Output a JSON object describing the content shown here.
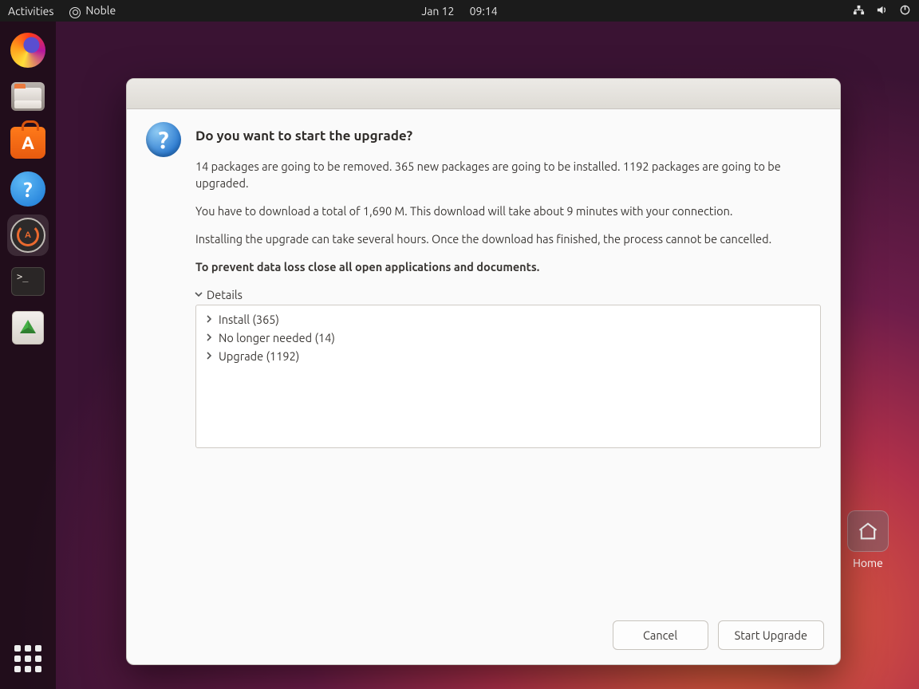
{
  "topbar": {
    "activities": "Activities",
    "app_name": "Noble",
    "date": "Jan 12",
    "time": "09:14"
  },
  "desktop": {
    "home_label": "Home"
  },
  "dialog": {
    "title": "Do you want to start the upgrade?",
    "line1": "14 packages are going to be removed. 365 new packages are going to be installed. 1192 packages are going to be upgraded.",
    "line2": "You have to download a total of 1,690 M. This download will take about 9 minutes with your connection.",
    "line3": "Installing the upgrade can take several hours. Once the download has finished, the process cannot be cancelled.",
    "warning": "To prevent data loss close all open applications and documents.",
    "details_label": "Details",
    "tree": [
      "Install (365)",
      "No longer needed (14)",
      "Upgrade (1192)"
    ],
    "cancel": "Cancel",
    "start": "Start Upgrade"
  }
}
